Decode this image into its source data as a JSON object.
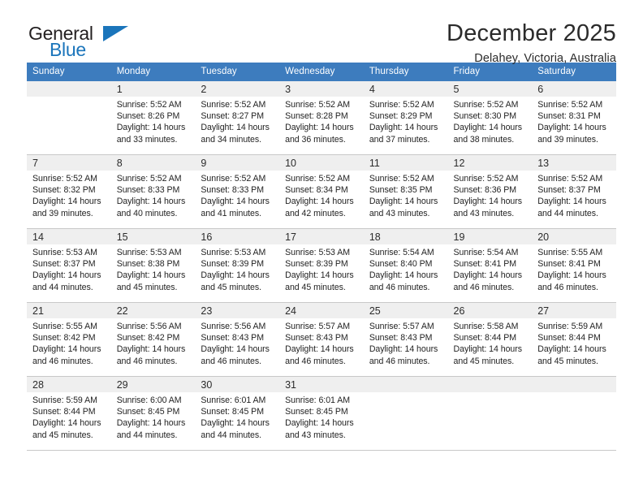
{
  "brand": {
    "name_top": "General",
    "name_bottom": "Blue",
    "triangle_color": "#1b75bb"
  },
  "header": {
    "title": "December 2025",
    "location": "Delahey, Victoria, Australia"
  },
  "colors": {
    "header_blue": "#3d7cbe",
    "daynum_band": "#efefef",
    "grid_line": "#c8c8c8",
    "text": "#232323"
  },
  "weekday_headers": [
    "Sunday",
    "Monday",
    "Tuesday",
    "Wednesday",
    "Thursday",
    "Friday",
    "Saturday"
  ],
  "weeks": [
    [
      {
        "day": "",
        "lines": [
          "",
          "",
          "",
          ""
        ]
      },
      {
        "day": "1",
        "lines": [
          "Sunrise: 5:52 AM",
          "Sunset: 8:26 PM",
          "Daylight: 14 hours",
          "and 33 minutes."
        ]
      },
      {
        "day": "2",
        "lines": [
          "Sunrise: 5:52 AM",
          "Sunset: 8:27 PM",
          "Daylight: 14 hours",
          "and 34 minutes."
        ]
      },
      {
        "day": "3",
        "lines": [
          "Sunrise: 5:52 AM",
          "Sunset: 8:28 PM",
          "Daylight: 14 hours",
          "and 36 minutes."
        ]
      },
      {
        "day": "4",
        "lines": [
          "Sunrise: 5:52 AM",
          "Sunset: 8:29 PM",
          "Daylight: 14 hours",
          "and 37 minutes."
        ]
      },
      {
        "day": "5",
        "lines": [
          "Sunrise: 5:52 AM",
          "Sunset: 8:30 PM",
          "Daylight: 14 hours",
          "and 38 minutes."
        ]
      },
      {
        "day": "6",
        "lines": [
          "Sunrise: 5:52 AM",
          "Sunset: 8:31 PM",
          "Daylight: 14 hours",
          "and 39 minutes."
        ]
      }
    ],
    [
      {
        "day": "7",
        "lines": [
          "Sunrise: 5:52 AM",
          "Sunset: 8:32 PM",
          "Daylight: 14 hours",
          "and 39 minutes."
        ]
      },
      {
        "day": "8",
        "lines": [
          "Sunrise: 5:52 AM",
          "Sunset: 8:33 PM",
          "Daylight: 14 hours",
          "and 40 minutes."
        ]
      },
      {
        "day": "9",
        "lines": [
          "Sunrise: 5:52 AM",
          "Sunset: 8:33 PM",
          "Daylight: 14 hours",
          "and 41 minutes."
        ]
      },
      {
        "day": "10",
        "lines": [
          "Sunrise: 5:52 AM",
          "Sunset: 8:34 PM",
          "Daylight: 14 hours",
          "and 42 minutes."
        ]
      },
      {
        "day": "11",
        "lines": [
          "Sunrise: 5:52 AM",
          "Sunset: 8:35 PM",
          "Daylight: 14 hours",
          "and 43 minutes."
        ]
      },
      {
        "day": "12",
        "lines": [
          "Sunrise: 5:52 AM",
          "Sunset: 8:36 PM",
          "Daylight: 14 hours",
          "and 43 minutes."
        ]
      },
      {
        "day": "13",
        "lines": [
          "Sunrise: 5:52 AM",
          "Sunset: 8:37 PM",
          "Daylight: 14 hours",
          "and 44 minutes."
        ]
      }
    ],
    [
      {
        "day": "14",
        "lines": [
          "Sunrise: 5:53 AM",
          "Sunset: 8:37 PM",
          "Daylight: 14 hours",
          "and 44 minutes."
        ]
      },
      {
        "day": "15",
        "lines": [
          "Sunrise: 5:53 AM",
          "Sunset: 8:38 PM",
          "Daylight: 14 hours",
          "and 45 minutes."
        ]
      },
      {
        "day": "16",
        "lines": [
          "Sunrise: 5:53 AM",
          "Sunset: 8:39 PM",
          "Daylight: 14 hours",
          "and 45 minutes."
        ]
      },
      {
        "day": "17",
        "lines": [
          "Sunrise: 5:53 AM",
          "Sunset: 8:39 PM",
          "Daylight: 14 hours",
          "and 45 minutes."
        ]
      },
      {
        "day": "18",
        "lines": [
          "Sunrise: 5:54 AM",
          "Sunset: 8:40 PM",
          "Daylight: 14 hours",
          "and 46 minutes."
        ]
      },
      {
        "day": "19",
        "lines": [
          "Sunrise: 5:54 AM",
          "Sunset: 8:41 PM",
          "Daylight: 14 hours",
          "and 46 minutes."
        ]
      },
      {
        "day": "20",
        "lines": [
          "Sunrise: 5:55 AM",
          "Sunset: 8:41 PM",
          "Daylight: 14 hours",
          "and 46 minutes."
        ]
      }
    ],
    [
      {
        "day": "21",
        "lines": [
          "Sunrise: 5:55 AM",
          "Sunset: 8:42 PM",
          "Daylight: 14 hours",
          "and 46 minutes."
        ]
      },
      {
        "day": "22",
        "lines": [
          "Sunrise: 5:56 AM",
          "Sunset: 8:42 PM",
          "Daylight: 14 hours",
          "and 46 minutes."
        ]
      },
      {
        "day": "23",
        "lines": [
          "Sunrise: 5:56 AM",
          "Sunset: 8:43 PM",
          "Daylight: 14 hours",
          "and 46 minutes."
        ]
      },
      {
        "day": "24",
        "lines": [
          "Sunrise: 5:57 AM",
          "Sunset: 8:43 PM",
          "Daylight: 14 hours",
          "and 46 minutes."
        ]
      },
      {
        "day": "25",
        "lines": [
          "Sunrise: 5:57 AM",
          "Sunset: 8:43 PM",
          "Daylight: 14 hours",
          "and 46 minutes."
        ]
      },
      {
        "day": "26",
        "lines": [
          "Sunrise: 5:58 AM",
          "Sunset: 8:44 PM",
          "Daylight: 14 hours",
          "and 45 minutes."
        ]
      },
      {
        "day": "27",
        "lines": [
          "Sunrise: 5:59 AM",
          "Sunset: 8:44 PM",
          "Daylight: 14 hours",
          "and 45 minutes."
        ]
      }
    ],
    [
      {
        "day": "28",
        "lines": [
          "Sunrise: 5:59 AM",
          "Sunset: 8:44 PM",
          "Daylight: 14 hours",
          "and 45 minutes."
        ]
      },
      {
        "day": "29",
        "lines": [
          "Sunrise: 6:00 AM",
          "Sunset: 8:45 PM",
          "Daylight: 14 hours",
          "and 44 minutes."
        ]
      },
      {
        "day": "30",
        "lines": [
          "Sunrise: 6:01 AM",
          "Sunset: 8:45 PM",
          "Daylight: 14 hours",
          "and 44 minutes."
        ]
      },
      {
        "day": "31",
        "lines": [
          "Sunrise: 6:01 AM",
          "Sunset: 8:45 PM",
          "Daylight: 14 hours",
          "and 43 minutes."
        ]
      },
      {
        "day": "",
        "lines": [
          "",
          "",
          "",
          ""
        ]
      },
      {
        "day": "",
        "lines": [
          "",
          "",
          "",
          ""
        ]
      },
      {
        "day": "",
        "lines": [
          "",
          "",
          "",
          ""
        ]
      }
    ]
  ]
}
